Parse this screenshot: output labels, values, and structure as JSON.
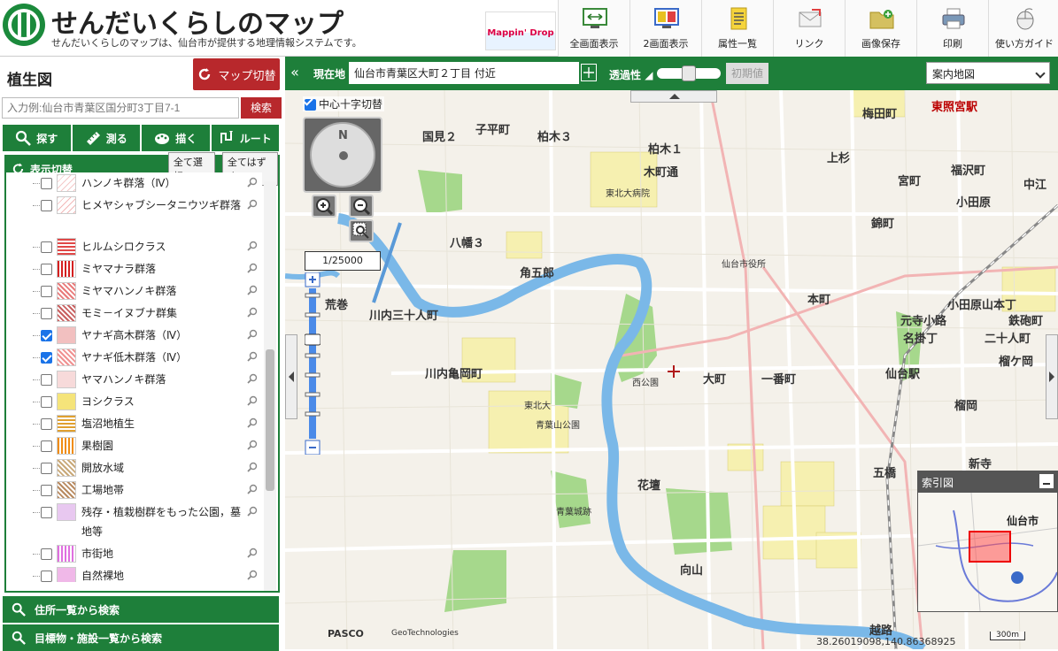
{
  "header": {
    "title": "せんだいくらしのマップ",
    "subtitle": "せんだいくらしのマップは、仙台市が提供する地理情報システムです。",
    "banner_text": "Mappin' Drop",
    "tools": [
      {
        "label": "全画面表示",
        "icon": "fullscreen-icon"
      },
      {
        "label": "2画面表示",
        "icon": "dual-screen-icon"
      },
      {
        "label": "属性一覧",
        "icon": "attribute-list-icon"
      },
      {
        "label": "リンク",
        "icon": "link-icon"
      },
      {
        "label": "画像保存",
        "icon": "save-image-icon"
      },
      {
        "label": "印刷",
        "icon": "print-icon"
      },
      {
        "label": "使い方ガイド",
        "icon": "guide-icon"
      }
    ]
  },
  "sidebar": {
    "title": "植生図",
    "map_switch": "マップ切替",
    "search_placeholder": "入力例:仙台市青葉区国分町3丁目7-1",
    "search_button": "検索",
    "tabs": [
      {
        "label": "探す",
        "icon": "search-icon"
      },
      {
        "label": "測る",
        "icon": "ruler-icon"
      },
      {
        "label": "描く",
        "icon": "palette-icon"
      },
      {
        "label": "ルート",
        "icon": "route-icon"
      }
    ],
    "panel_title": "表示切替",
    "select_all": "全て選択",
    "deselect_all": "全てはずす",
    "layers": [
      {
        "label": "ハンノキ群落（Ⅳ）",
        "checked": false,
        "color": "#f5c8c8"
      },
      {
        "label": "ヒメヤシャブシータニウツギ群落",
        "checked": false,
        "color": "#f2b8b8"
      },
      {
        "label": "ヒルムシロクラス",
        "checked": false,
        "color": "#e04848"
      },
      {
        "label": "ミヤマナラ群落",
        "checked": false,
        "color": "#d42020"
      },
      {
        "label": "ミヤマハンノキ群落",
        "checked": false,
        "color": "#e87a7a"
      },
      {
        "label": "モミ－イヌブナ群集",
        "checked": false,
        "color": "#c86060"
      },
      {
        "label": "ヤナギ高木群落（Ⅳ）",
        "checked": true,
        "color": "#f2c0c0"
      },
      {
        "label": "ヤナギ低木群落（Ⅳ）",
        "checked": true,
        "color": "#f09090"
      },
      {
        "label": "ヤマハンノキ群落",
        "checked": false,
        "color": "#f7dada"
      },
      {
        "label": "ヨシクラス",
        "checked": false,
        "color": "#f5e47a"
      },
      {
        "label": "塩沼地植生",
        "checked": false,
        "color": "#e0a030"
      },
      {
        "label": "果樹園",
        "checked": false,
        "color": "#f08c10"
      },
      {
        "label": "開放水域",
        "checked": false,
        "color": "#c8a878"
      },
      {
        "label": "工場地帯",
        "checked": false,
        "color": "#b88a60"
      },
      {
        "label": "残存・植栽樹群をもった公園，墓地等",
        "checked": false,
        "color": "#e8c8f0"
      },
      {
        "label": "市街地",
        "checked": false,
        "color": "#e070e0"
      },
      {
        "label": "自然裸地",
        "checked": false,
        "color": "#f0b8e8"
      }
    ],
    "bottom_links": [
      {
        "label": "住所一覧から検索",
        "icon": "search-icon"
      },
      {
        "label": "目標物・施設一覧から検索",
        "icon": "search-icon"
      }
    ]
  },
  "mapbar": {
    "location_label": "現在地",
    "address": "仙台市青葉区大町２丁目 付近",
    "transparency_label": "透過性",
    "transparency": 0.5,
    "reset_label": "初期値",
    "map_type": "案内地図"
  },
  "map": {
    "crosshair_label": "中心十字切替",
    "crosshair_checked": true,
    "compass_label": "N",
    "scale_label": "1/25000",
    "index_title": "索引図",
    "index_city": "仙台市",
    "coordinates": "38.26019098,140.86368925",
    "scalebar_label": "300m",
    "credit_pasco": "PASCO",
    "credit_geo": "GeoTechnologies",
    "labels": [
      {
        "text": "梅田町"
      },
      {
        "text": "東照宮駅"
      },
      {
        "text": "子平町"
      },
      {
        "text": "柏木３"
      },
      {
        "text": "国見２"
      },
      {
        "text": "柏木１"
      },
      {
        "text": "上杉"
      },
      {
        "text": "木町通"
      },
      {
        "text": "宮町"
      },
      {
        "text": "福沢町"
      },
      {
        "text": "中江"
      },
      {
        "text": "小田原"
      },
      {
        "text": "錦町"
      },
      {
        "text": "八幡３"
      },
      {
        "text": "角五郎"
      },
      {
        "text": "本町"
      },
      {
        "text": "荒巻"
      },
      {
        "text": "川内三十人町"
      },
      {
        "text": "元寺小路"
      },
      {
        "text": "鉄砲町"
      },
      {
        "text": "名掛丁"
      },
      {
        "text": "二十人町"
      },
      {
        "text": "川内亀岡町"
      },
      {
        "text": "大町"
      },
      {
        "text": "一番町"
      },
      {
        "text": "仙台駅"
      },
      {
        "text": "榴ケ岡"
      },
      {
        "text": "西公園"
      },
      {
        "text": "東北大"
      },
      {
        "text": "青葉山公園"
      },
      {
        "text": "五橋"
      },
      {
        "text": "新寺"
      },
      {
        "text": "花壇"
      },
      {
        "text": "青葉城跡"
      },
      {
        "text": "向山"
      },
      {
        "text": "越路"
      },
      {
        "text": "小田原山本丁"
      },
      {
        "text": "榴岡"
      },
      {
        "text": "東北大病院"
      },
      {
        "text": "仙台市役所"
      }
    ]
  }
}
